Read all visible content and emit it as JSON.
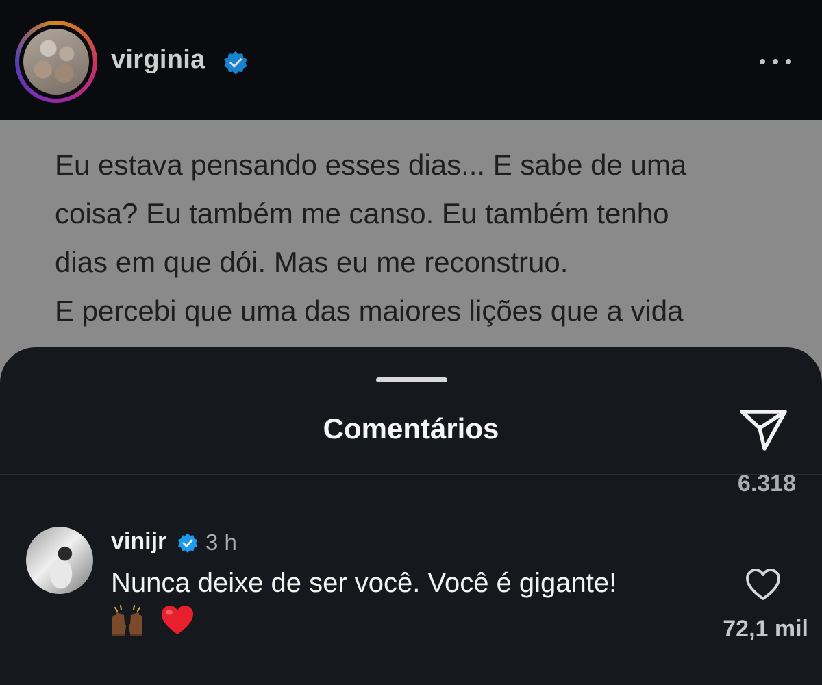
{
  "post": {
    "username": "virginia",
    "verified_icon": "verified-badge",
    "more_icon": "more-horizontal",
    "caption": "Eu estava pensando esses dias... E sabe de uma\ncoisa? Eu também me canso. Eu também tenho\ndias em que dói. Mas eu me reconstruo.\nE percebi que uma das maiores lições que a vida\nme ensinou até hoje foi que as pessoas sempre"
  },
  "comments_sheet": {
    "title": "Comentários",
    "share_icon": "paper-plane",
    "previous_like_count": "6.318",
    "comment": {
      "username": "vinijr",
      "time": "3 h",
      "text": "Nunca deixe de ser você. Você é gigante!",
      "emoji": [
        "raised-hands-emoji",
        "red-heart-emoji"
      ],
      "like_count": "72,1 mil"
    }
  },
  "colors": {
    "verified_blue": "#1d9bf0",
    "heart_red": "#e8202e"
  }
}
